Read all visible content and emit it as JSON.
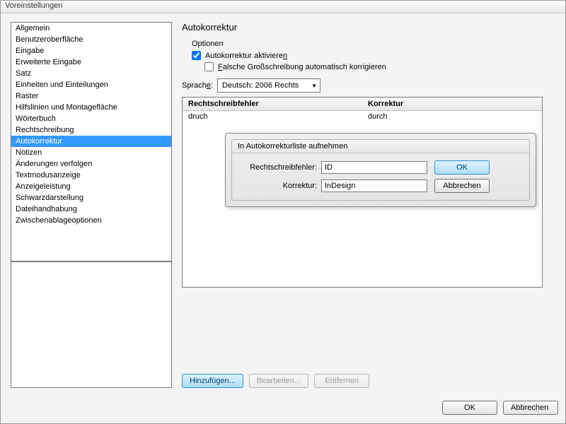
{
  "window": {
    "title": "Voreinstellungen"
  },
  "sidebar": {
    "items": [
      "Allgemein",
      "Benutzeroberfläche",
      "Eingabe",
      "Erweiterte Eingabe",
      "Satz",
      "Einheiten und Einteilungen",
      "Raster",
      "Hilfslinien und Montagefläche",
      "Wörterbuch",
      "Rechtschreibung",
      "Autokorrektur",
      "Notizen",
      "Änderungen verfolgen",
      "Textmodusanzeige",
      "Anzeigeleistung",
      "Schwarzdarstellung",
      "Dateihandhabung",
      "Zwischenablageoptionen"
    ],
    "selected": "Autokorrektur"
  },
  "main": {
    "title": "Autokorrektur",
    "options_label": "Optionen",
    "enable_label_pre": "Autokorrektur aktiviere",
    "enable_label_u": "n",
    "caps_label_u": "F",
    "caps_label_post": "alsche Großschreibung automatisch korrigieren",
    "language_label_pre": "Sprach",
    "language_label_u": "e",
    "language_label_post": ":",
    "language_value": "Deutsch: 2006 Rechts",
    "table": {
      "col1": "Rechtschreibfehler",
      "col2": "Korrektur",
      "rows": [
        {
          "err": "druch",
          "fix": "durch"
        }
      ]
    },
    "modal": {
      "title": "In Autokorrekturliste aufnehmen",
      "field1_label": "Rechtschreibfehler:",
      "field1_value": "ID",
      "field2_label": "Korrektur:",
      "field2_value": "InDesign",
      "ok": "OK",
      "cancel": "Abbrechen"
    },
    "actions": {
      "add": "Hinzufügen...",
      "edit": "Bearbeiten...",
      "remove": "Entfernen"
    }
  },
  "footer": {
    "ok": "OK",
    "cancel": "Abbrechen"
  }
}
